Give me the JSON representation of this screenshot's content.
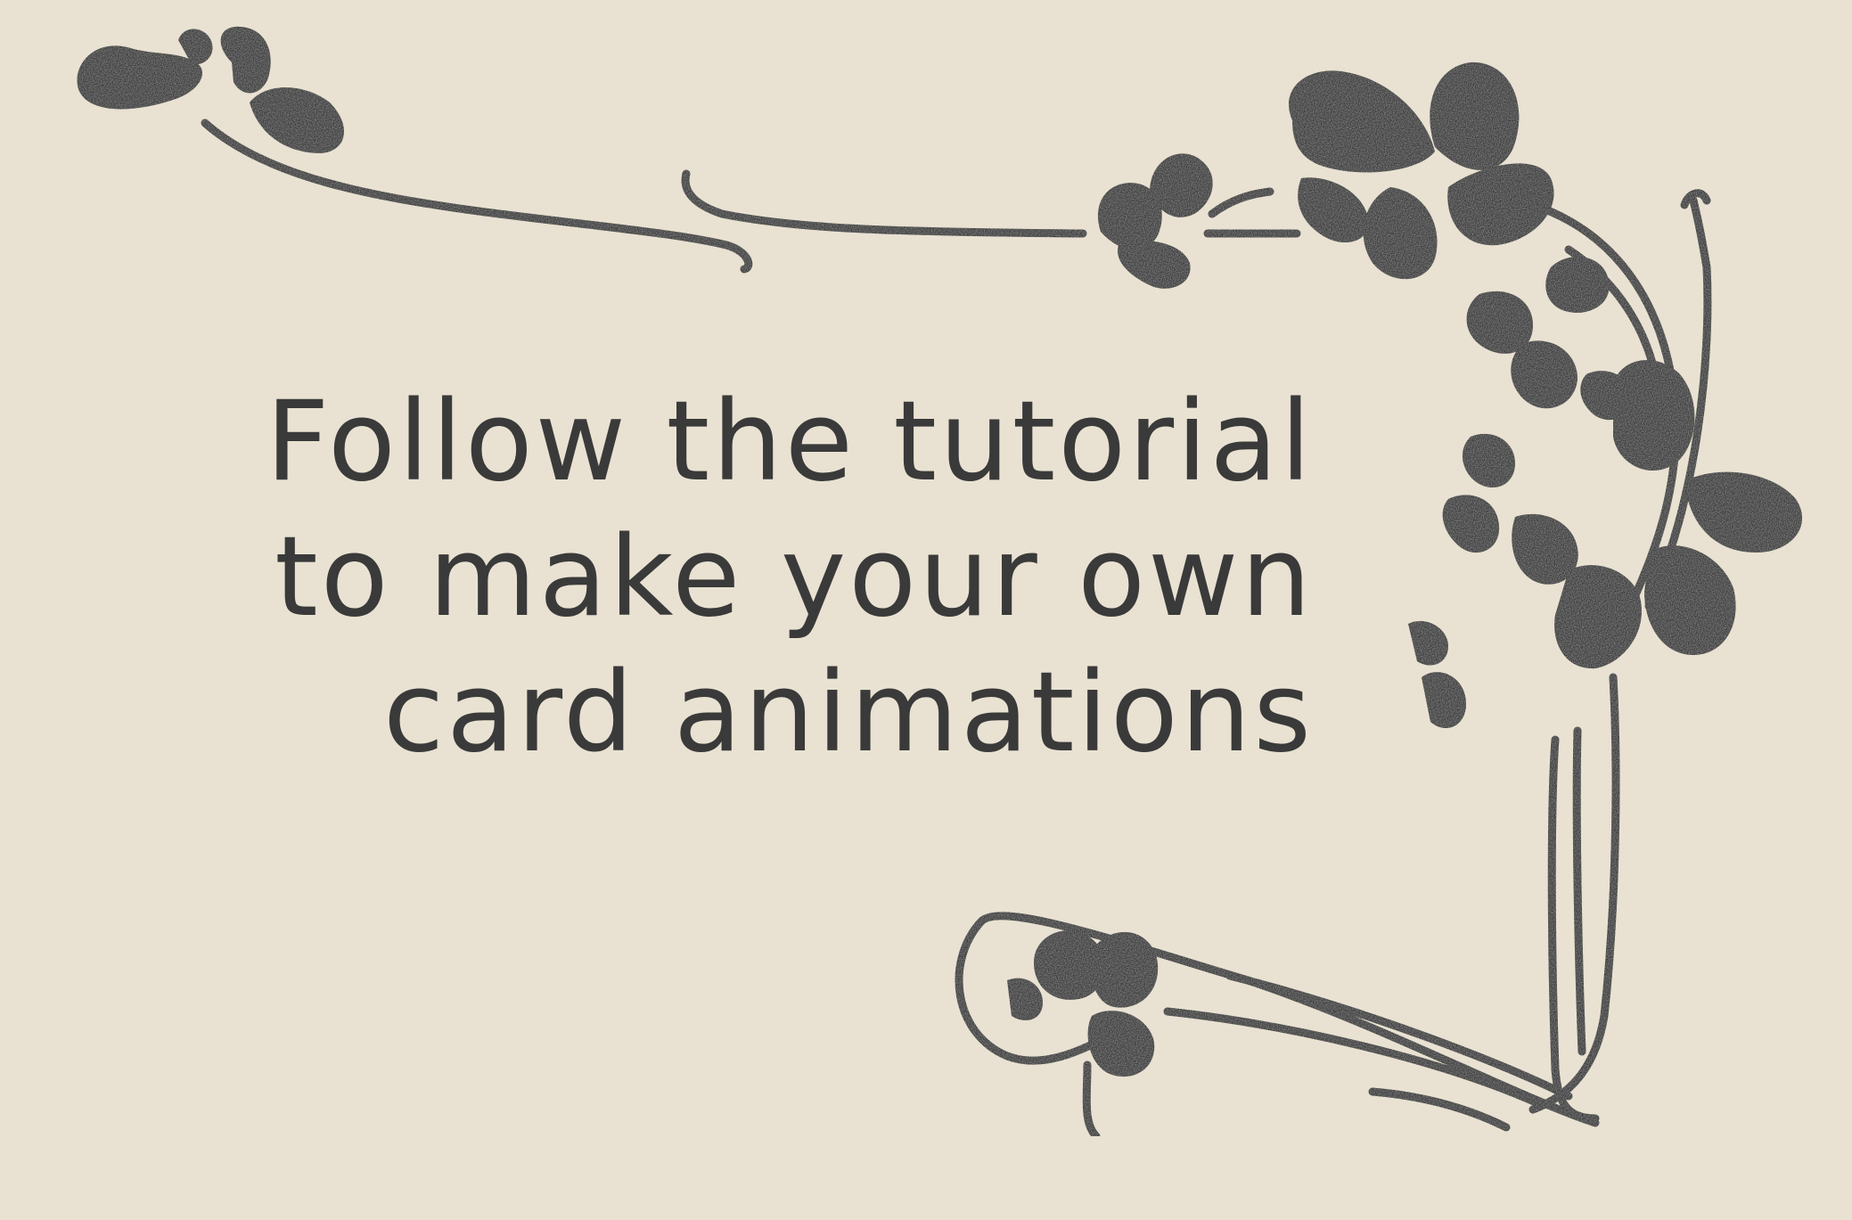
{
  "card": {
    "lines": [
      "Follow the tutorial",
      "to make your own",
      "card animations"
    ]
  },
  "colors": {
    "background": "#e9e2d2",
    "ink": "#3a3a3a"
  },
  "decoration": {
    "style": "art-nouveau-stencil",
    "motif": "clover-vine-frame",
    "icons": [
      "clover-icon",
      "vine-icon"
    ]
  }
}
